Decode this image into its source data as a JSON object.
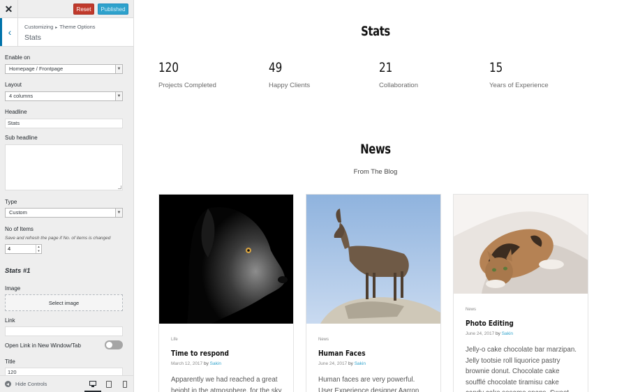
{
  "header": {
    "close_label": "✕",
    "reset_label": "Reset",
    "publish_label": "Published"
  },
  "section": {
    "back_label": "‹",
    "breadcrumb": [
      "Customizing",
      "▸",
      "Theme Options"
    ],
    "title": "Stats"
  },
  "controls": {
    "enable_on": {
      "label": "Enable on",
      "value": "Homepage / Frontpage"
    },
    "layout": {
      "label": "Layout",
      "value": "4 columns"
    },
    "headline": {
      "label": "Headline",
      "value": "Stats"
    },
    "sub_headline": {
      "label": "Sub headline",
      "value": ""
    },
    "type": {
      "label": "Type",
      "value": "Custom"
    },
    "no_of_items": {
      "label": "No of Items",
      "hint": "Save and refresh the page if No. of items is changed",
      "value": "4"
    },
    "group_title": "Stats #1",
    "image": {
      "label": "Image",
      "button": "Select image"
    },
    "link": {
      "label": "Link",
      "value": ""
    },
    "open_new_window": {
      "label": "Open Link in New Window/Tab",
      "checked": false
    },
    "title_field": {
      "label": "Title",
      "value": "120"
    }
  },
  "footer": {
    "hide_controls_label": "Hide Controls",
    "devices": [
      "desktop-icon",
      "tablet-icon",
      "mobile-icon"
    ],
    "active_device": "desktop"
  },
  "preview": {
    "stats_heading": "Stats",
    "stats": [
      {
        "number": "120",
        "label": "Projects Completed"
      },
      {
        "number": "49",
        "label": "Happy Clients"
      },
      {
        "number": "21",
        "label": "Collaboration"
      },
      {
        "number": "15",
        "label": "Years of Experience"
      }
    ],
    "news_heading": "News",
    "news_subtitle": "From The Blog",
    "posts": [
      {
        "category": "Life",
        "title": "Time to respond",
        "date": "March 12, 2017",
        "by": "by",
        "author": "Sakin",
        "excerpt": "Apparently we had reached a great height in the atmosphere, for the sky"
      },
      {
        "category": "News",
        "title": "Human Faces",
        "date": "June 24, 2017",
        "by": "by",
        "author": "Sakin",
        "excerpt": "Human faces are very powerful. User Experience designer Aarron Walter"
      },
      {
        "category": "News",
        "title": "Photo Editing",
        "date": "June 24, 2017",
        "by": "by",
        "author": "Sakin",
        "excerpt": "Jelly-o cake chocolate bar marzipan. Jelly tootsie roll liquorice pastry brownie donut. Chocolate cake soufflé chocolate tiramisu cake candy cake sesame snaps. Sweet roll danish"
      }
    ]
  }
}
